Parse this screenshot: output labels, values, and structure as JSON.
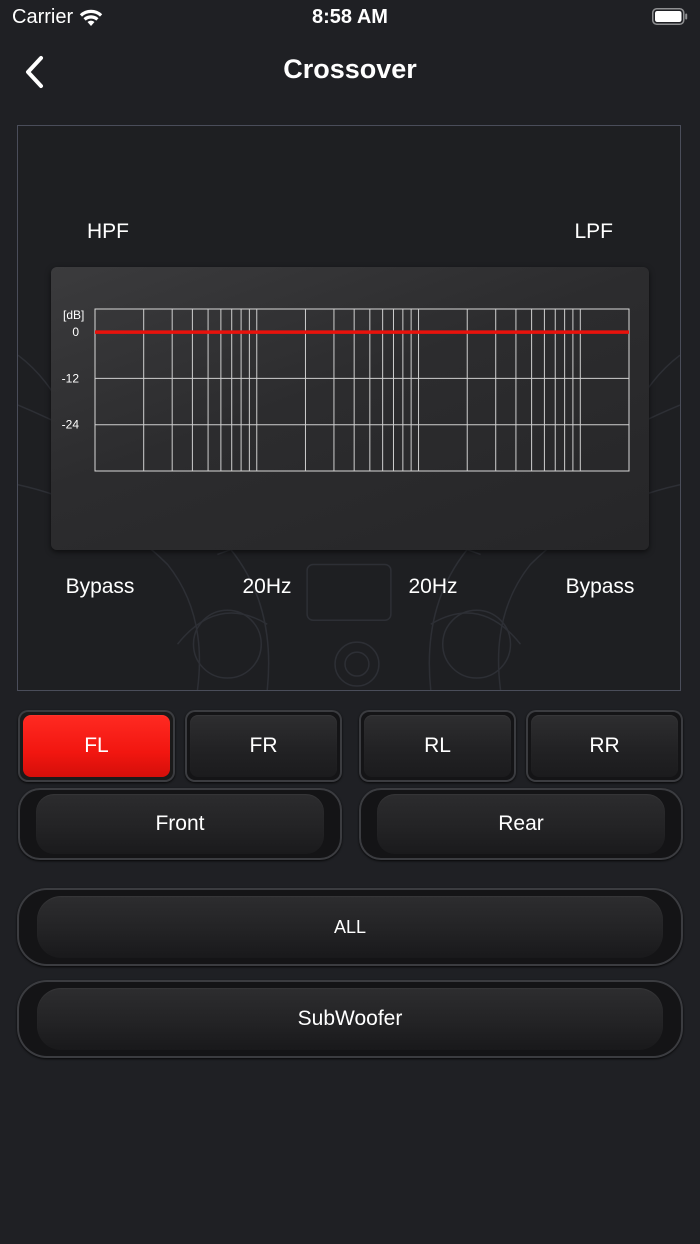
{
  "status_bar": {
    "carrier": "Carrier",
    "time": "8:58 AM"
  },
  "nav": {
    "title": "Crossover",
    "back_icon": "chevron-left-icon"
  },
  "crossover": {
    "hpf_label": "HPF",
    "lpf_label": "LPF",
    "graph": {
      "unit_label": "[dB]",
      "y_ticks": [
        "0",
        "-12",
        "-24"
      ],
      "response_level_db": 0,
      "response_color": "#e8120c"
    },
    "hpf_value": "Bypass",
    "hpf_freq": "20Hz",
    "lpf_freq": "20Hz",
    "lpf_value": "Bypass"
  },
  "channels": {
    "fl": "FL",
    "fr": "FR",
    "rl": "RL",
    "rr": "RR",
    "selected": "FL"
  },
  "groups": {
    "front": "Front",
    "rear": "Rear"
  },
  "all_label": "ALL",
  "subwoofer_label": "SubWoofer",
  "colors": {
    "background": "#1f2024",
    "accent": "#f21610"
  }
}
